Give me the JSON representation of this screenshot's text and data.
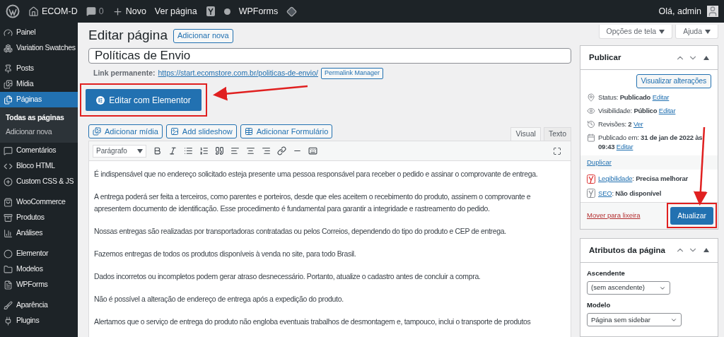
{
  "admin_bar": {
    "site": "ECOM-D",
    "comments": "0",
    "new": "Novo",
    "view": "Ver página",
    "forms": "WPForms",
    "greeting": "Olá, admin"
  },
  "sidebar": {
    "groups": [
      [
        {
          "label": "Painel",
          "selected": false
        },
        {
          "label": "Variation Swatches",
          "selected": false
        }
      ],
      [
        {
          "label": "Posts",
          "selected": false
        },
        {
          "label": "Mídia",
          "selected": false
        },
        {
          "label": "Páginas",
          "selected": true,
          "children": [
            {
              "label": "Todas as páginas",
              "selected": true
            },
            {
              "label": "Adicionar nova",
              "selected": false
            }
          ]
        },
        {
          "label": "Comentários",
          "selected": false
        },
        {
          "label": "Bloco HTML",
          "selected": false
        },
        {
          "label": "Custom CSS & JS",
          "selected": false
        }
      ],
      [
        {
          "label": "WooCommerce",
          "selected": false
        },
        {
          "label": "Produtos",
          "selected": false
        },
        {
          "label": "Análises",
          "selected": false
        }
      ],
      [
        {
          "label": "Elementor",
          "selected": false
        },
        {
          "label": "Modelos",
          "selected": false
        },
        {
          "label": "WPForms",
          "selected": false
        }
      ],
      [
        {
          "label": "Aparência",
          "selected": false
        },
        {
          "label": "Plugins",
          "selected": false
        }
      ]
    ]
  },
  "screen_options": [
    "Opções de tela",
    "Ajuda"
  ],
  "header": {
    "title": "Editar página",
    "add_new": "Adicionar nova"
  },
  "post_title": "Políticas de Envio",
  "permalink": {
    "label": "Link permanente:",
    "url": "https://start.ecomstore.com.br/politicas-de-envio/",
    "button": "Permalink Manager"
  },
  "elementor_button": "Editar com Elementor",
  "media_buttons": [
    "Adicionar mídia",
    "Add slideshow",
    "Adicionar Formulário"
  ],
  "editor_tabs": [
    {
      "label": "Visual",
      "selected": true
    },
    {
      "label": "Texto",
      "selected": false
    }
  ],
  "format_select": "Parágrafo",
  "paragraphs": [
    "É indispensável que no endereço solicitado esteja presente uma pessoa responsável para receber o pedido e assinar o comprovante de entrega.",
    "A entrega poderá ser feita a terceiros, como parentes e porteiros, desde que eles aceitem o recebimento do produto, assinem o comprovante e apresentem documento de identificação. Esse procedimento é fundamental para garantir a integridade e rastreamento do pedido.",
    "Nossas entregas são realizadas por transportadoras contratadas ou pelos Correios, dependendo do tipo do produto e CEP de entrega.",
    "Fazemos entregas de todos os produtos disponíveis à venda no site, para todo Brasil.",
    "Dados incorretos ou incompletos podem gerar atraso desnecessário. Portanto, atualize o cadastro antes de concluir a compra.",
    "Não é possível a alteração de endereço de entrega após a expedição do produto.",
    "Alertamos que o serviço de entrega do produto não engloba eventuais trabalhos de desmontagem e, tampouco, inclui o transporte de produtos"
  ],
  "publish": {
    "title": "Publicar",
    "preview": "Visualizar alterações",
    "rows": [
      {
        "kind": "status",
        "text": "Status: **Publicado**",
        "link": "Editar"
      },
      {
        "kind": "visibility",
        "text": "Visibilidade: **Público**",
        "link": "Editar"
      },
      {
        "kind": "revisions",
        "text": "Revisões: **2**",
        "link": "Ver"
      },
      {
        "kind": "date",
        "text": "Publicado em: **31 de jan de 2022 às 09:43**",
        "link": "Editar"
      }
    ],
    "duplicate": "Duplicar",
    "seo": [
      {
        "link": "Legibilidade",
        "text": ": **Precisa melhorar**",
        "color": "#dc3232"
      },
      {
        "link": "SEO",
        "text": ": **Não disponível**",
        "color": "#8c8f94"
      }
    ],
    "trash": "Mover para lixeira",
    "update": "Atualizar"
  },
  "attributes": {
    "title": "Atributos da página",
    "parent_label": "Ascendente",
    "parent_value": "(sem ascendente)",
    "template_label": "Modelo",
    "template_value": "Página sem sidebar"
  }
}
